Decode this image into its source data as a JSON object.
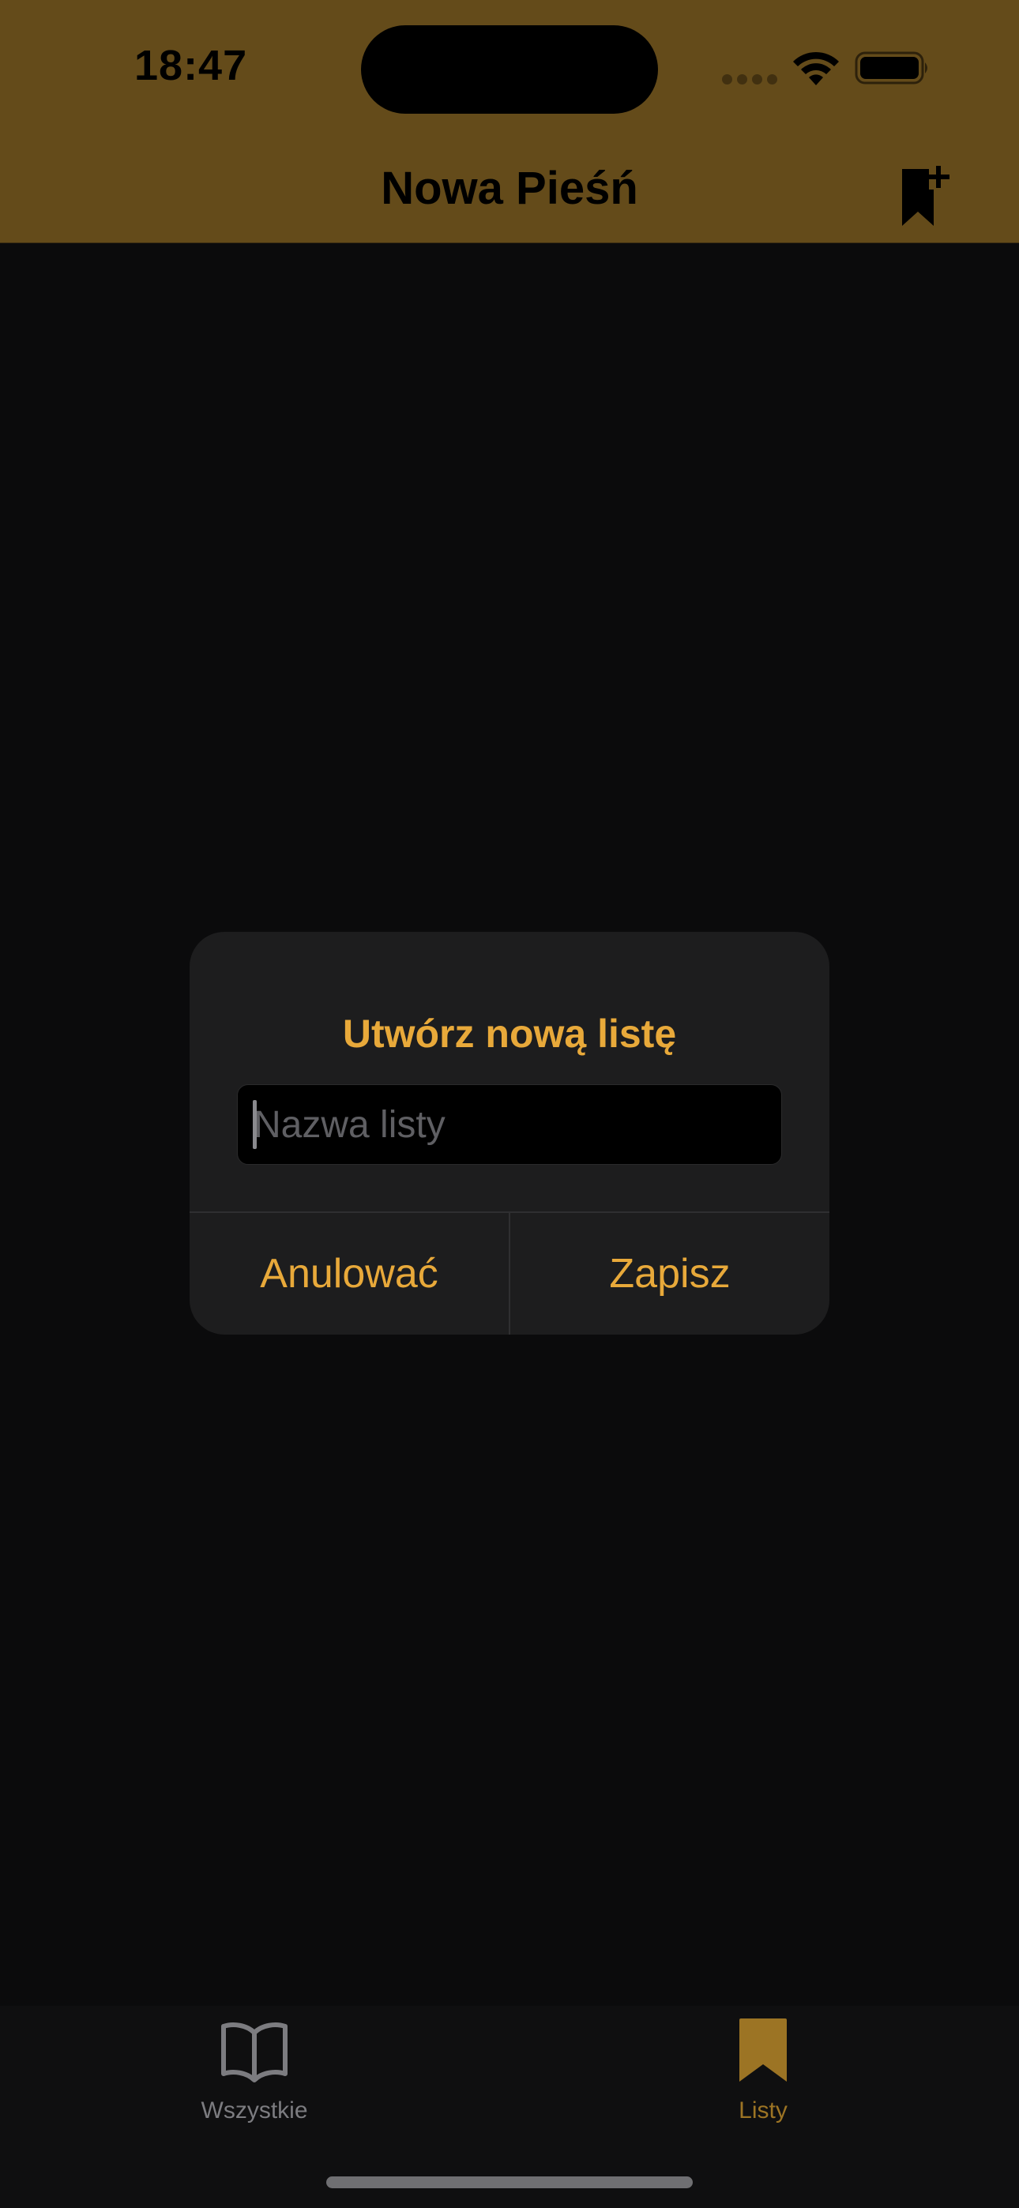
{
  "status_bar": {
    "time": "18:47"
  },
  "header": {
    "title": "Nowa Pieśń",
    "add_list_icon": "bookmark-plus-icon"
  },
  "dialog": {
    "title": "Utwórz nową listę",
    "input": {
      "placeholder": "Nazwa listy",
      "value": ""
    },
    "cancel_label": "Anulować",
    "save_label": "Zapisz"
  },
  "tab_bar": {
    "tabs": [
      {
        "label": "Wszystkie",
        "icon": "book-icon",
        "selected": false
      },
      {
        "label": "Listy",
        "icon": "bookmark-icon",
        "selected": true
      }
    ]
  },
  "colors": {
    "header_background": "#644b1a",
    "accent": "#e8a93a",
    "background": "#0b0b0c",
    "dialog_background": "#1d1d1e",
    "tab_selected": "#9c7424",
    "tab_unselected": "#7c7c80"
  }
}
